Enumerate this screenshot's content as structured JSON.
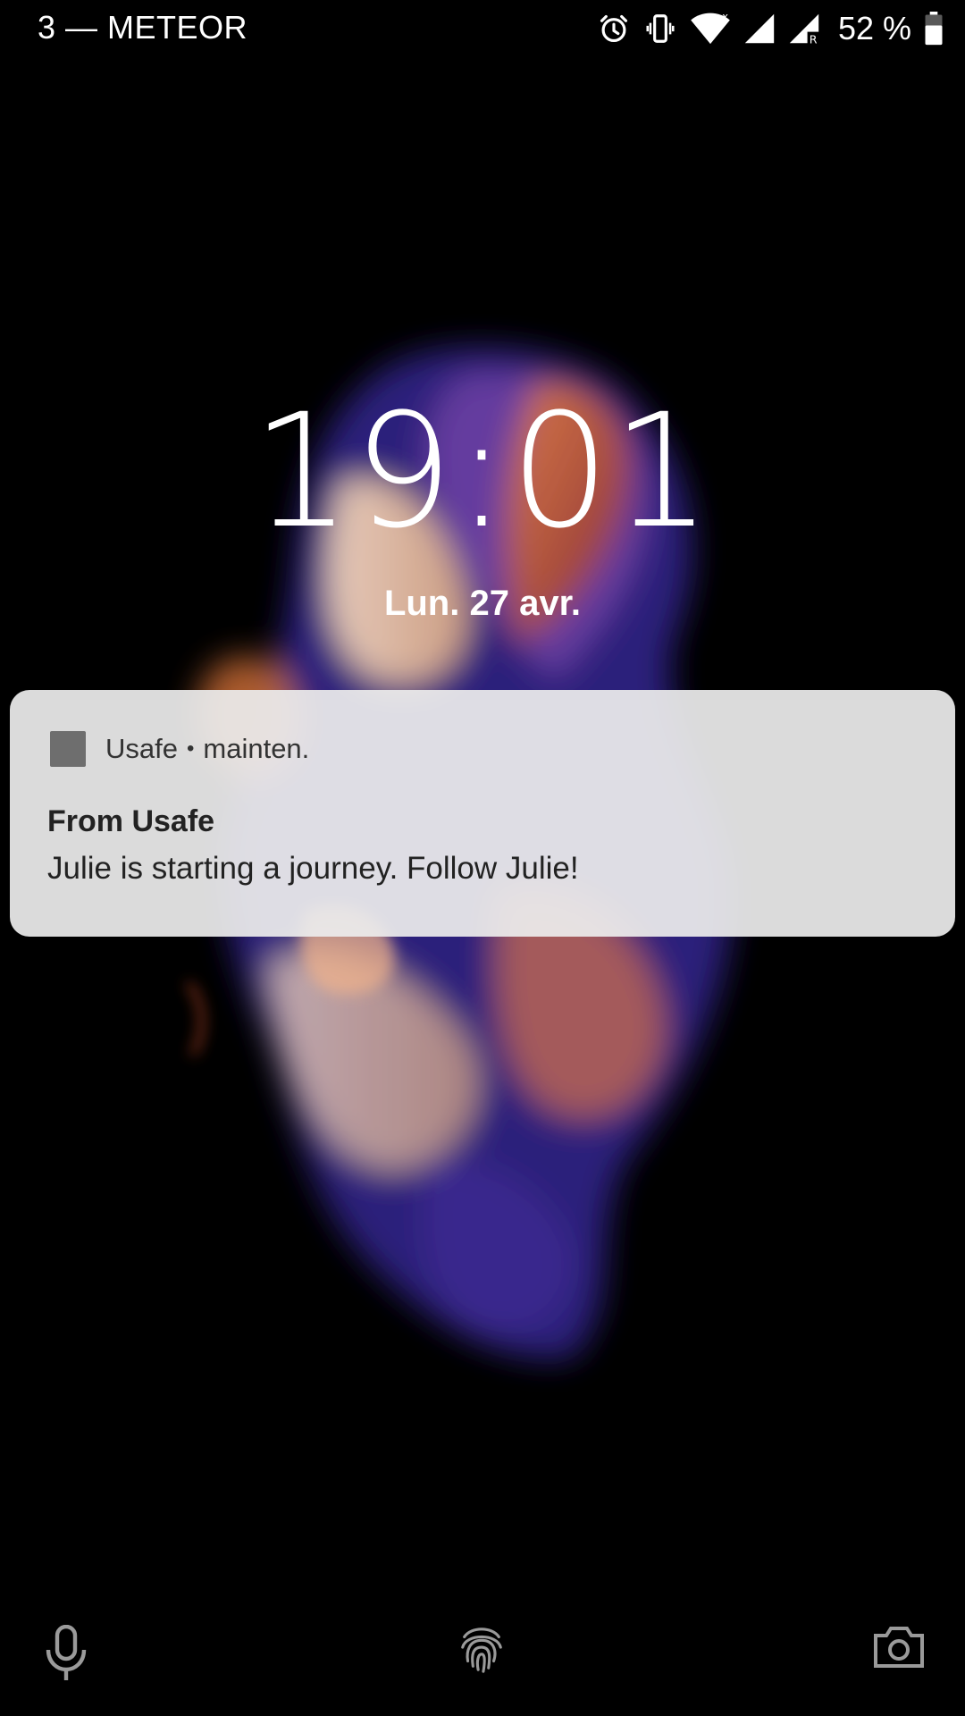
{
  "status_bar": {
    "carrier": "3 — METEOR",
    "battery_percent": "52 %",
    "icons": [
      "alarm-icon",
      "vibrate-icon",
      "wifi-icon",
      "signal-icon",
      "signal-roaming-icon",
      "battery-icon"
    ]
  },
  "lockscreen": {
    "time": "19:01",
    "date": "Lun. 27 avr."
  },
  "notification": {
    "app_name": "Usafe",
    "separator": "•",
    "time": "mainten.",
    "title": "From Usafe",
    "body": "Julie is starting a journey. Follow Julie!"
  },
  "bottom_actions": [
    "microphone-icon",
    "fingerprint-icon",
    "camera-icon"
  ],
  "colors": {
    "background": "#000000",
    "notification_bg": "#ececec",
    "text_dark": "#222222",
    "icon_gray": "#6e6e6e"
  }
}
